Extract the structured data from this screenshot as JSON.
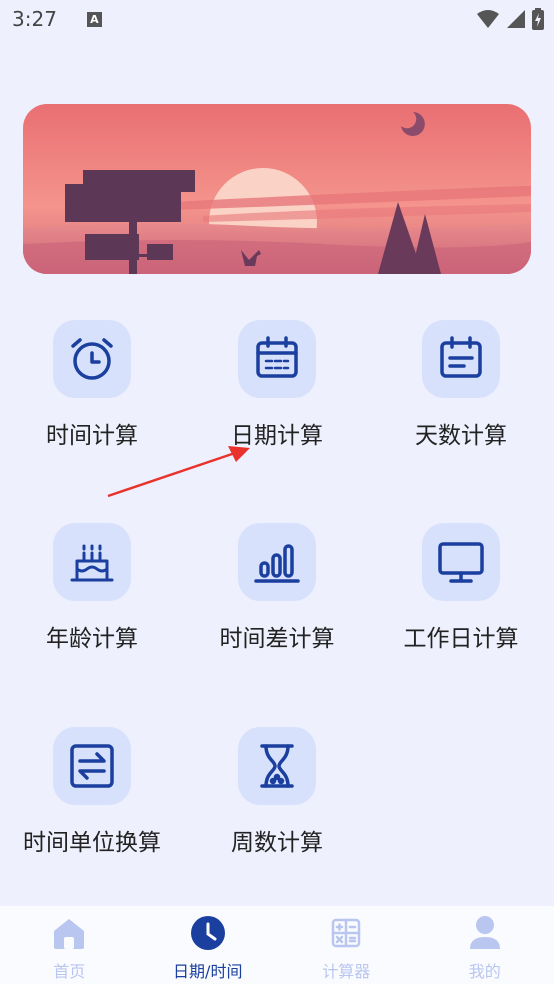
{
  "status_bar": {
    "time": "3:27",
    "notification_icon": "A"
  },
  "grid": [
    {
      "label": "时间计算",
      "icon": "alarm-clock-icon"
    },
    {
      "label": "日期计算",
      "icon": "calendar-icon"
    },
    {
      "label": "天数计算",
      "icon": "calendar-days-icon"
    },
    {
      "label": "年龄计算",
      "icon": "birthday-cake-icon"
    },
    {
      "label": "时间差计算",
      "icon": "bar-chart-icon"
    },
    {
      "label": "工作日计算",
      "icon": "monitor-icon"
    },
    {
      "label": "时间单位换算",
      "icon": "swap-icon"
    },
    {
      "label": "周数计算",
      "icon": "hourglass-icon"
    }
  ],
  "nav": [
    {
      "label": "首页",
      "icon": "home-icon",
      "active": false
    },
    {
      "label": "日期/时间",
      "icon": "clock-icon",
      "active": true
    },
    {
      "label": "计算器",
      "icon": "calculator-icon",
      "active": false
    },
    {
      "label": "我的",
      "icon": "user-icon",
      "active": false
    }
  ],
  "colors": {
    "accent": "#1a3f9e",
    "icon_bg": "#d8e1fb",
    "inactive": "#b9c6ef",
    "annotation_arrow": "#e8322b"
  }
}
